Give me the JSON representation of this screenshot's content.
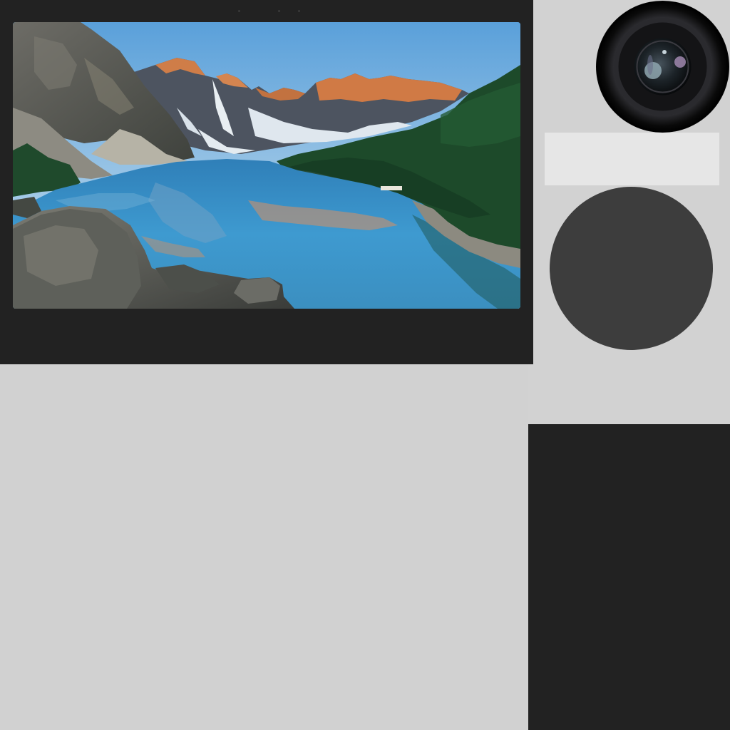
{
  "screen": {
    "wallpaper": "mountain-lake-landscape",
    "colors": {
      "bezel": "#222222",
      "sky_top": "#5aa0da",
      "sky_bottom": "#c9e0ee",
      "lake": "#3d95cc",
      "forest": "#1d4a2a",
      "peaks_lit": "#d07a45",
      "rock": "#5d5f5e"
    }
  },
  "camera": {
    "icon": "camera-lens-icon"
  },
  "controls": {
    "round_button_icon": "round-button",
    "round_button_color": "#3d3d3d"
  },
  "background": {
    "color": "#d2d2d2"
  }
}
